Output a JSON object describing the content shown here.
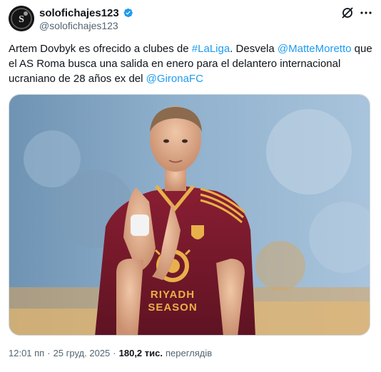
{
  "author": {
    "display_name": "solofichajes123",
    "handle": "@solofichajes123",
    "verified": true,
    "verified_color": "#1d9bf0"
  },
  "tweet": {
    "segments": [
      {
        "text": "Artem Dovbyk es ofrecido a clubes de ",
        "link": false
      },
      {
        "text": "#LaLiga",
        "link": true
      },
      {
        "text": ". Desvela ",
        "link": false
      },
      {
        "text": "@MatteMoretto",
        "link": true
      },
      {
        "text": " que el AS Roma busca una salida en enero para el delantero internacional ucraniano de 28 años ex del ",
        "link": false
      },
      {
        "text": "@GironaFC",
        "link": true
      }
    ],
    "link_color": "#1d9bf0"
  },
  "media": {
    "jersey_text_line1": "RIYADH",
    "jersey_text_line2": "SEASON",
    "jersey_color": "#7a1a2c",
    "trim_color": "#e8b04a"
  },
  "meta": {
    "time": "12:01 пп",
    "separator": "·",
    "date": "25 груд. 2025",
    "views_count": "180,2 тис.",
    "views_label": "переглядів"
  },
  "icons": {
    "grok": "grok-icon",
    "more": "more-icon",
    "verified": "verified-badge-icon"
  }
}
